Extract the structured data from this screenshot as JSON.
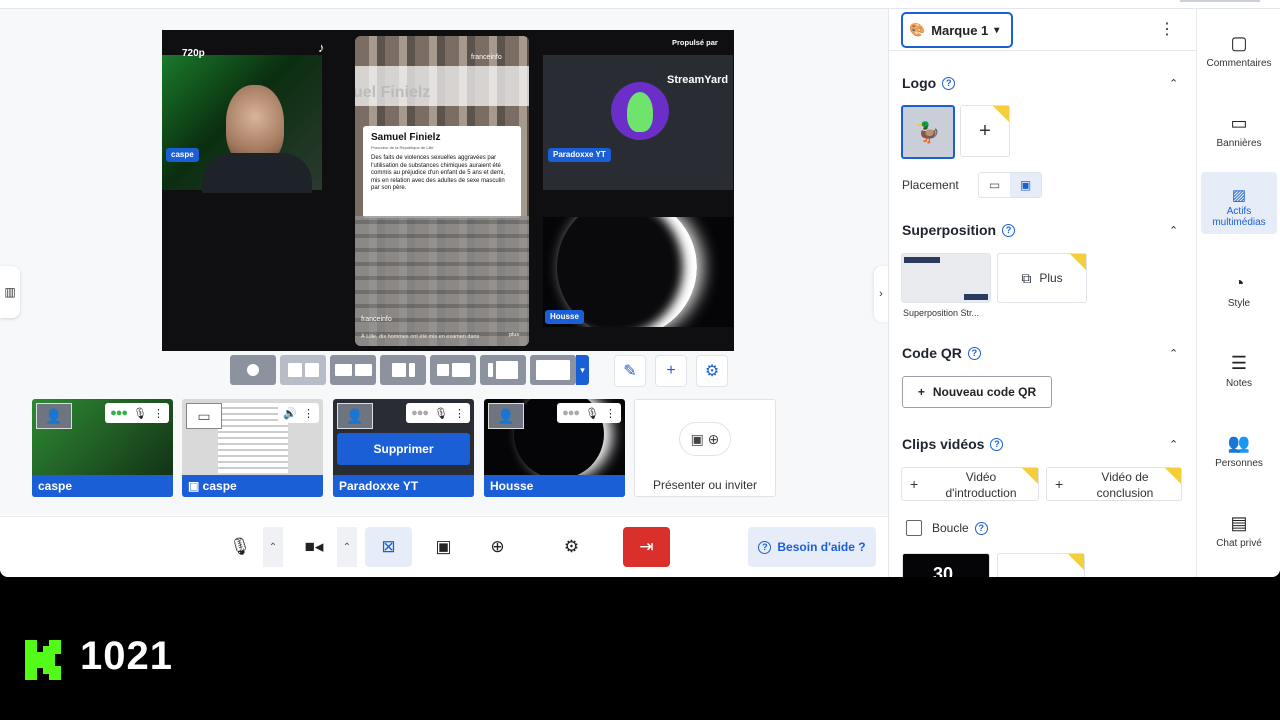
{
  "stage": {
    "resolution": "720p",
    "powered_by": "Propulsé par",
    "streamyard": "StreamYard",
    "cam1_label": "caspe",
    "cam2_label": "Paradoxxe YT",
    "cam3_label": "Housse",
    "news": {
      "source": "franceinfo",
      "name": "Samuel Finielz",
      "role": "Procureur de la République de Lille",
      "body": "Des faits de violences sexuelles aggravées par l'utilisation de substances chimiques auraient été commis au préjudice d'un enfant de 5 ans et demi, mis en relation avec des adultes de sexe masculin par son père.",
      "footer": "À Lille, dix hommes ont été mis en examen dans",
      "more": "plus",
      "bg_title": "uel Finielz"
    }
  },
  "participants": [
    {
      "name": "caspe"
    },
    {
      "name": "caspe"
    },
    {
      "name": "Paradoxxe YT"
    },
    {
      "name": "Housse"
    }
  ],
  "present_invite": "Présenter ou inviter",
  "remove_label": "Supprimer",
  "help_label": "Besoin d'aide ?",
  "brand": {
    "selected": "Marque 1",
    "logo_title": "Logo",
    "placement_label": "Placement",
    "overlay_title": "Superposition",
    "overlay_more": "Plus",
    "overlay_caption": "Superposition Str...",
    "qr_title": "Code QR",
    "qr_button": "Nouveau code QR",
    "clips_title": "Clips vidéos",
    "intro_line1": "Vidéo",
    "intro_line2": "d'introduction",
    "outro_line1": "Vidéo de",
    "outro_line2": "conclusion",
    "loop_label": "Boucle",
    "countdown": "30"
  },
  "rail": [
    {
      "label": "Commentaires",
      "icon": "comment-icon"
    },
    {
      "label": "Bannières",
      "icon": "banner-icon"
    },
    {
      "label": "Actifs multimédias",
      "icon": "media-icon"
    },
    {
      "label": "Style",
      "icon": "palette-icon"
    },
    {
      "label": "Notes",
      "icon": "notes-icon"
    },
    {
      "label": "Personnes",
      "icon": "people-icon"
    },
    {
      "label": "Chat privé",
      "icon": "chat-icon"
    }
  ],
  "overlay_count": "1021",
  "colors": {
    "accent": "#1b5fd6",
    "leave": "#d9302c",
    "premium": "#f5cf3a"
  }
}
